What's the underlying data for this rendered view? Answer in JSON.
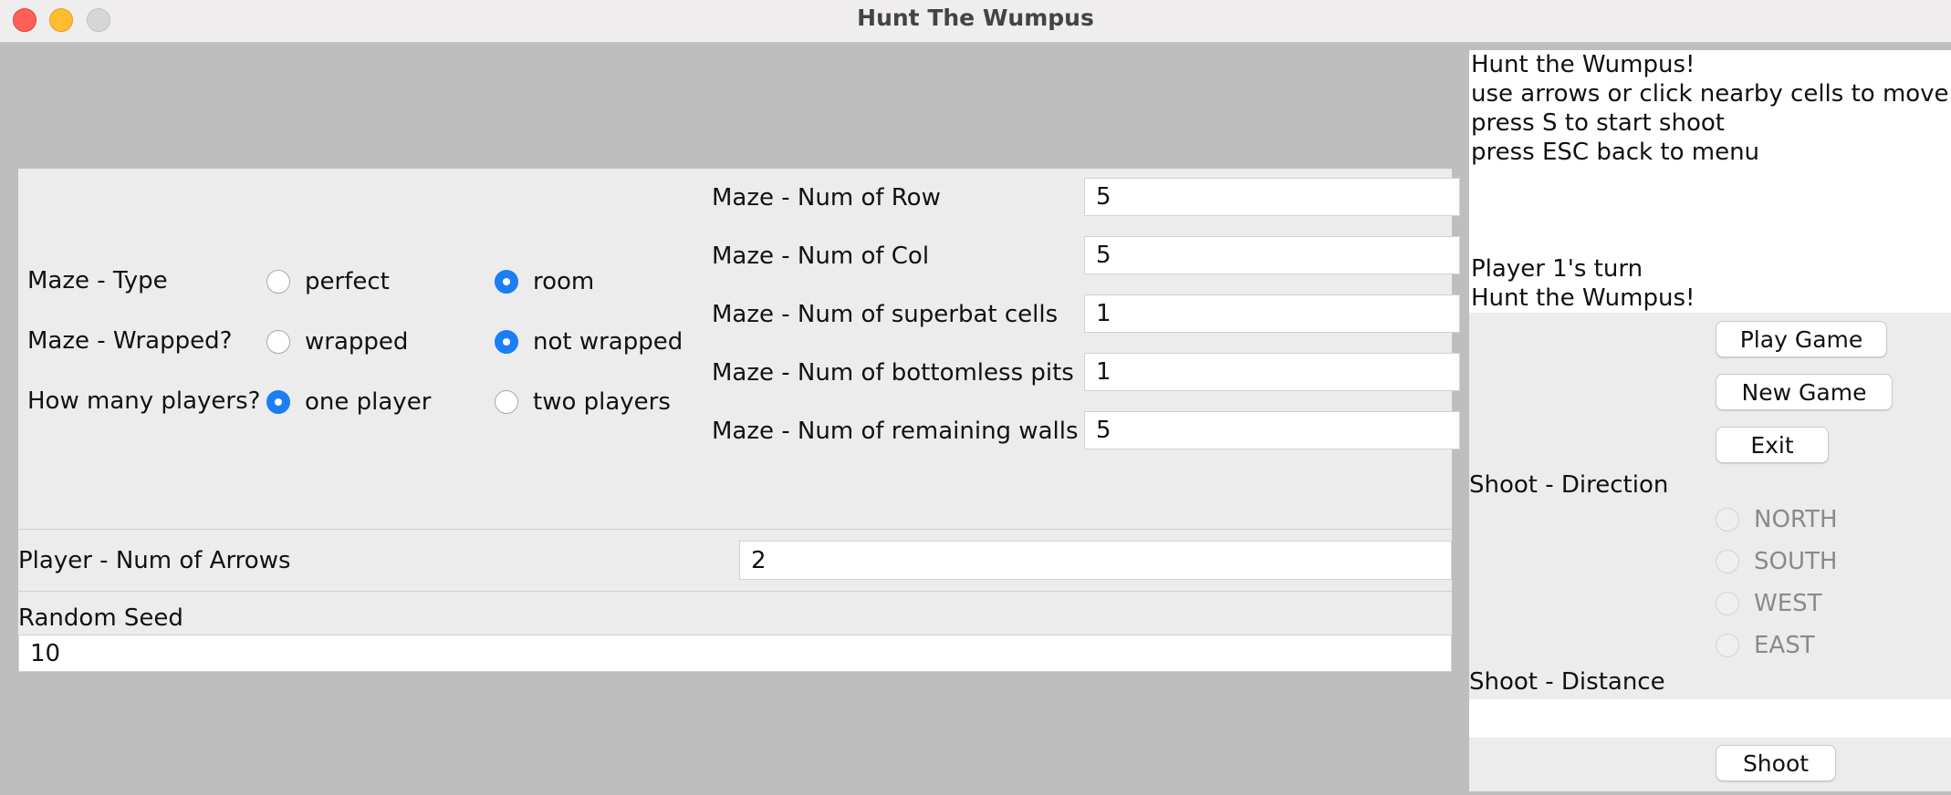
{
  "window": {
    "title": "Hunt The Wumpus"
  },
  "settings": {
    "maze_type": {
      "label": "Maze - Type",
      "options": [
        "perfect",
        "room"
      ],
      "selected": "room"
    },
    "maze_wrapped": {
      "label": "Maze - Wrapped?",
      "options": [
        "wrapped",
        "not wrapped"
      ],
      "selected": "not wrapped"
    },
    "players": {
      "label": "How many players?",
      "options": [
        "one player",
        "two players"
      ],
      "selected": "one player"
    },
    "num_rows": {
      "label": "Maze - Num of Row",
      "value": "5"
    },
    "num_cols": {
      "label": "Maze - Num of Col",
      "value": "5"
    },
    "superbat": {
      "label": "Maze - Num of superbat cells",
      "value": "1"
    },
    "pits": {
      "label": "Maze - Num of bottomless pits",
      "value": "1"
    },
    "walls": {
      "label": "Maze - Num of remaining walls",
      "value": "5"
    },
    "arrows": {
      "label": "Player - Num of Arrows",
      "value": "2"
    },
    "seed": {
      "label": "Random Seed",
      "value": "10"
    }
  },
  "messages": {
    "lines": [
      "Hunt the Wumpus!",
      "use arrows or click nearby cells to move",
      "press S to start shoot",
      "press ESC back to menu",
      "Player 1's turn",
      "Hunt the Wumpus!"
    ]
  },
  "controls": {
    "play_label": "Play Game",
    "new_label": "New Game",
    "exit_label": "Exit",
    "direction_label": "Shoot - Direction",
    "directions": [
      "NORTH",
      "SOUTH",
      "WEST",
      "EAST"
    ],
    "distance_label": "Shoot - Distance",
    "distance_value": "",
    "shoot_label": "Shoot"
  },
  "colors": {
    "accent": "#1a7ff5",
    "panel": "#ececec",
    "background": "#bebebe"
  }
}
